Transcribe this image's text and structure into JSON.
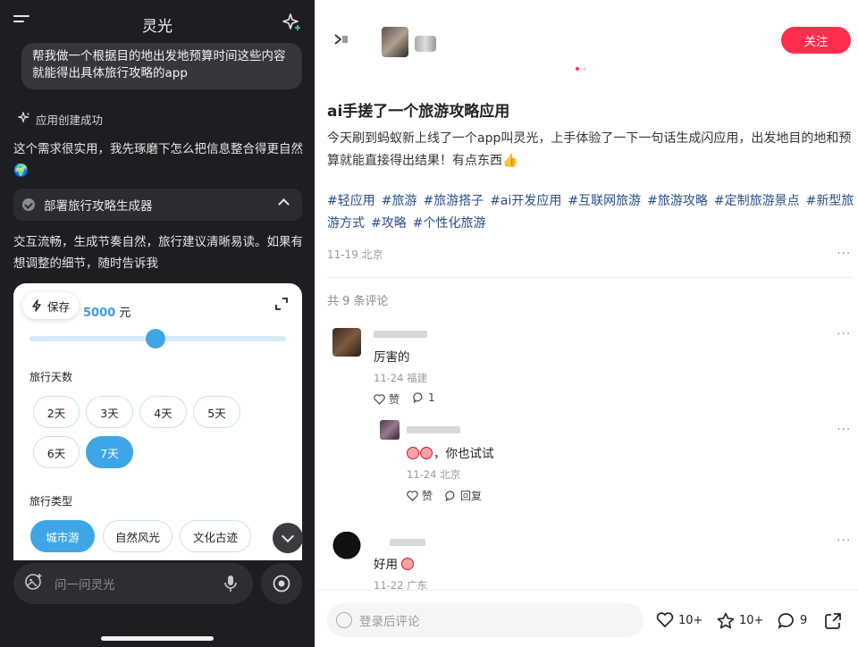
{
  "left": {
    "app_title": "灵光",
    "user_message": "帮我做一个根据目的地出发地预算时间这些内容就能得出具体旅行攻略的app",
    "status": "应用创建成功",
    "reply1": "这个需求很实用，我先琢磨下怎么把信息整合得更自然 🌍",
    "deploy_card": "部署旅行攻略生成器",
    "reply2": "交互流畅，生成节奏自然，旅行建议清晰易读。如果有想调整的细节，随时告诉我",
    "preview": {
      "save_label": "保存",
      "budget_value": "5000",
      "budget_unit": " 元",
      "slider_fraction": 0.49,
      "days_label": "旅行天数",
      "days": [
        "2天",
        "3天",
        "4天",
        "5天",
        "6天",
        "7天"
      ],
      "days_selected": "7天",
      "type_label": "旅行类型",
      "types": [
        "城市游",
        "自然风光",
        "文化古迹"
      ],
      "type_selected": "城市游"
    },
    "ask_placeholder": "问一问灵光",
    "colors": {
      "accent": "#3ea6e6",
      "panel_bg": "#1d1e21"
    }
  },
  "right": {
    "follow_label": "关注",
    "post_title": "ai手搓了一个旅游攻略应用",
    "post_body": "今天刷到蚂蚁新上线了一个app叫灵光，上手体验了一下一句话生成闪应用，出发地目的地和预算就能直接得出结果！有点东西👍",
    "tags": [
      "#轻应用",
      "#旅游",
      "#旅游搭子",
      "#ai开发应用",
      "#互联网旅游",
      "#旅游攻略",
      "#定制旅游景点",
      "#新型旅游方式",
      "#攻略",
      "#个性化旅游"
    ],
    "post_meta": "11-19 北京",
    "comment_count": "共 9 条评论",
    "comments": [
      {
        "text": "厉害的",
        "meta": "11-24 福建",
        "like_label": "赞",
        "reply_count": "1"
      },
      {
        "text": "，你也试试",
        "meta": "11-24 北京",
        "like_label": "赞",
        "reply_label": "回复"
      },
      {
        "text": "好用",
        "meta": "11-22 广东"
      }
    ],
    "comment_placeholder": "登录后评论",
    "likes": "10+",
    "stars": "10+",
    "comments_total": "9",
    "colors": {
      "follow": "#ff2e4d",
      "tag": "#2a4d86"
    }
  }
}
